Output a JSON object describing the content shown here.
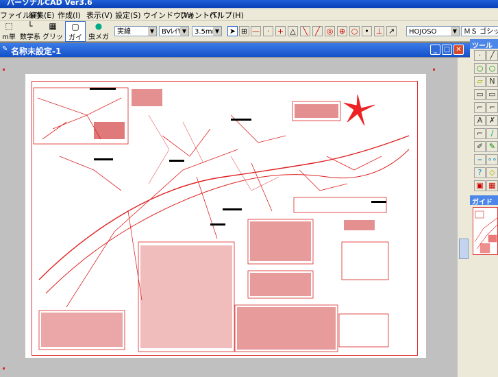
{
  "app": {
    "title": "パーソナルCAD Ver3.6"
  },
  "menu": [
    "ファイル(F)",
    "編集(E)",
    "作成(I)",
    "表示(V)",
    "設定(S)",
    "ウインドウ(W)",
    "フォント(T)",
    "ヘルプ(H)"
  ],
  "toolbar": {
    "unit_label": "m単位",
    "math_label": "数学系",
    "grid_label": "グリッド",
    "guide_label": "ガイド",
    "magnifier_label": "虫メガネ",
    "linetype": "実線",
    "layer": "BVﾚｲﾔｰ",
    "size": "3.5mm",
    "font_code": "HOJOSO",
    "font_name": "ＭＳ ゴシック"
  },
  "document": {
    "title": "名称未設定-1"
  },
  "tool_window": {
    "title": "ツール"
  },
  "guide_window": {
    "title": "ガイド"
  },
  "colors": {
    "accent_red": "#d22222",
    "titlebar_blue": "#1450c8"
  }
}
